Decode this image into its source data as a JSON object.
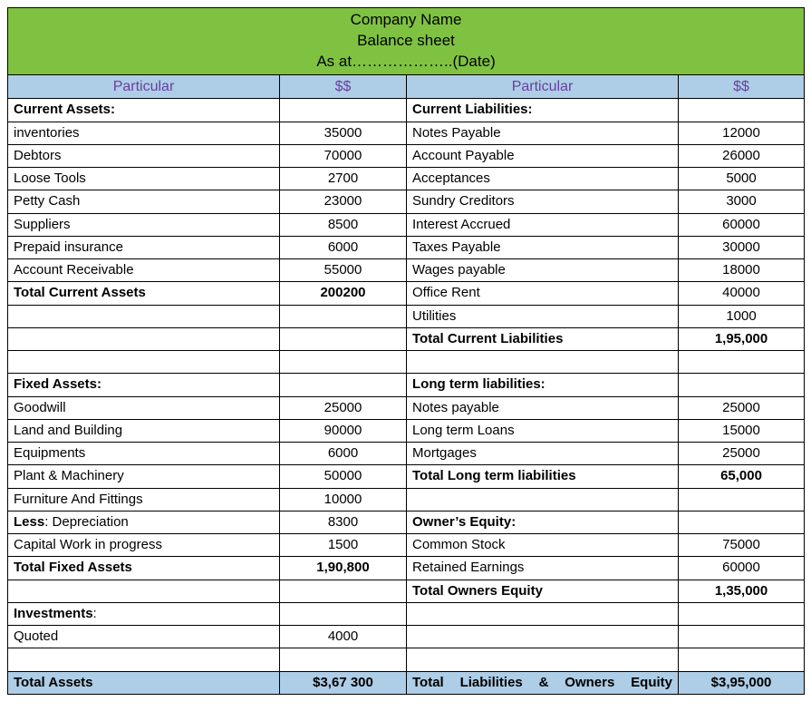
{
  "header": {
    "line1": "Company Name",
    "line2": "Balance sheet",
    "line3": "As at………………..(Date)"
  },
  "colhdr": {
    "particular": "Particular",
    "amount": "$$"
  },
  "left": {
    "ca_hdr": "Current Assets:",
    "ca": [
      {
        "label": " inventories",
        "value": "35000"
      },
      {
        "label": " Debtors",
        "value": "70000"
      },
      {
        "label": " Loose Tools",
        "value": "2700"
      },
      {
        "label": " Petty Cash",
        "value": "23000"
      },
      {
        "label": " Suppliers",
        "value": "8500"
      },
      {
        "label": " Prepaid insurance",
        "value": "6000"
      },
      {
        "label": " Account Receivable",
        "value": "55000"
      }
    ],
    "ca_total_label": "Total Current Assets",
    "ca_total_value": "200200",
    "fa_hdr": "Fixed Assets:",
    "fa": [
      {
        "label": " Goodwill",
        "value": "25000"
      },
      {
        "label": " Land and Building",
        "value": "90000"
      },
      {
        "label": " Equipments",
        "value": "6000"
      },
      {
        "label": " Plant & Machinery",
        "value": "50000"
      },
      {
        "label": " Furniture And Fittings",
        "value": "10000"
      }
    ],
    "less_label": "Less",
    "less_rest": ": Depreciation",
    "less_value": "8300",
    "cwip_label": "Capital Work in progress",
    "cwip_value": "1500",
    "fa_total_label": "Total Fixed Assets",
    "fa_total_value": "1,90,800",
    "inv_hdr": "Investments",
    "inv_colon": ":",
    "inv": [
      {
        "label": " Quoted",
        "value": "4000"
      }
    ],
    "grand_label": "Total Assets",
    "grand_value": "$3,67 300"
  },
  "right": {
    "cl_hdr": "Current Liabilities:",
    "cl": [
      {
        "label": " Notes Payable",
        "value": "12000"
      },
      {
        "label": " Account Payable",
        "value": "26000"
      },
      {
        "label": " Acceptances",
        "value": "5000"
      },
      {
        "label": " Sundry Creditors",
        "value": "3000"
      },
      {
        "label": " Interest Accrued",
        "value": "60000"
      },
      {
        "label": " Taxes Payable",
        "value": "30000"
      },
      {
        "label": " Wages payable",
        "value": "18000"
      },
      {
        "label": " Office Rent",
        "value": "40000"
      },
      {
        "label": " Utilities",
        "value": "1000"
      }
    ],
    "cl_total_label": "Total Current Liabilities",
    "cl_total_value": "1,95,000",
    "lt_hdr": "Long term liabilities:",
    "lt": [
      {
        "label": " Notes payable",
        "value": "25000"
      },
      {
        "label": " Long term Loans",
        "value": "15000"
      },
      {
        "label": " Mortgages",
        "value": "25000"
      }
    ],
    "lt_total_label": "Total Long term liabilities",
    "lt_total_value": "65,000",
    "oe_hdr": "Owner’s Equity:",
    "oe": [
      {
        "label": " Common Stock",
        "value": "75000"
      },
      {
        "label": " Retained Earnings",
        "value": "60000"
      }
    ],
    "oe_total_label": "Total Owners Equity",
    "oe_total_value": "1,35,000",
    "grand_label": "Total Liabilities & Owners Equity",
    "grand_value": "$3,95,000"
  }
}
